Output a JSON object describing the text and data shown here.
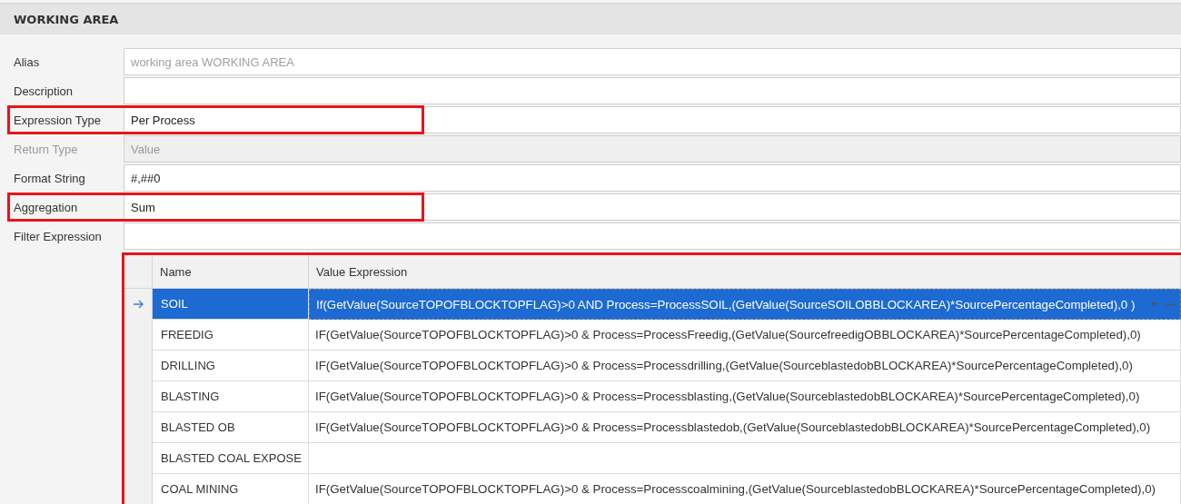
{
  "panel": {
    "title": "WORKING AREA"
  },
  "fields": [
    {
      "label": "Alias",
      "placeholder": "working area WORKING AREA",
      "disabled": false,
      "highlighted": false
    },
    {
      "label": "Description",
      "disabled": false,
      "highlighted": false
    },
    {
      "label": "Expression Type",
      "value": "Per Process",
      "disabled": false,
      "highlighted": true
    },
    {
      "label": "Return Type",
      "value": "Value",
      "disabled": true,
      "highlighted": false
    },
    {
      "label": "Format String",
      "value": "#,##0",
      "disabled": false,
      "highlighted": false
    },
    {
      "label": "Aggregation",
      "value": "Sum",
      "disabled": false,
      "highlighted": true
    },
    {
      "label": "Filter Expression",
      "disabled": false,
      "highlighted": false
    }
  ],
  "grid": {
    "highlighted": true,
    "columns": [
      "Name",
      "Value Expression"
    ],
    "rows": [
      {
        "name": "SOIL",
        "expression": "If(GetValue(SourceTOPOFBLOCKTOPFLAG)>0 AND Process=ProcessSOIL,(GetValue(SourceSOILOBBLOCKAREA)*SourcePercentageCompleted),0 )",
        "selected": true
      },
      {
        "name": "FREEDIG",
        "expression": "IF(GetValue(SourceTOPOFBLOCKTOPFLAG)>0 & Process=ProcessFreedig,(GetValue(SourcefreedigOBBLOCKAREA)*SourcePercentageCompleted),0)",
        "selected": false
      },
      {
        "name": "DRILLING",
        "expression": "IF(GetValue(SourceTOPOFBLOCKTOPFLAG)>0 & Process=Processdrilling,(GetValue(SourceblastedobBLOCKAREA)*SourcePercentageCompleted),0)",
        "selected": false
      },
      {
        "name": "BLASTING",
        "expression": "IF(GetValue(SourceTOPOFBLOCKTOPFLAG)>0 & Process=Processblasting,(GetValue(SourceblastedobBLOCKAREA)*SourcePercentageCompleted),0)",
        "selected": false
      },
      {
        "name": "BLASTED OB",
        "expression": "IF(GetValue(SourceTOPOFBLOCKTOPFLAG)>0 & Process=Processblastedob,(GetValue(SourceblastedobBLOCKAREA)*SourcePercentageCompleted),0)",
        "selected": false
      },
      {
        "name": "BLASTED COAL EXPOSE",
        "selected": false
      },
      {
        "name": "COAL MINING",
        "expression": "IF(GetValue(SourceTOPOFBLOCKTOPFLAG)>0 & Process=Processcoalmining,(GetValue(SourceblastedobBLOCKAREA)*SourcePercentageCompleted),0)",
        "selected": false
      }
    ]
  }
}
